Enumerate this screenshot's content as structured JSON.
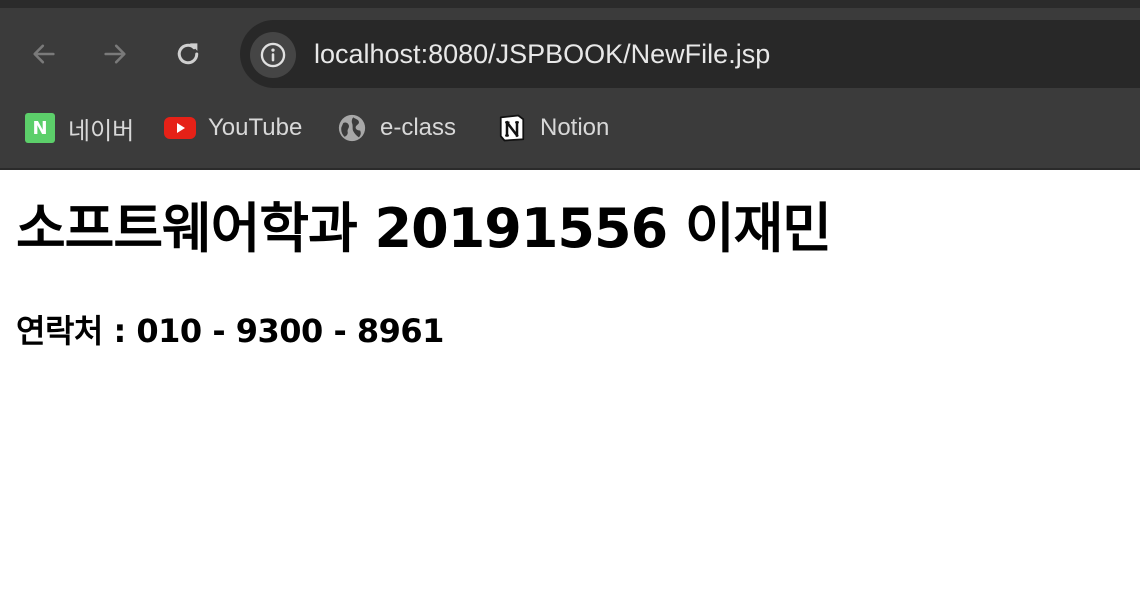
{
  "browser": {
    "url": "localhost:8080/JSPBOOK/NewFile.jsp",
    "toolbar_icons": [
      "back-arrow-icon",
      "forward-arrow-icon",
      "reload-icon",
      "info-icon"
    ],
    "bookmarks": [
      {
        "label": "네이버",
        "icon": "naver-icon",
        "icon_text": "N",
        "color": "#5ccf6a"
      },
      {
        "label": "YouTube",
        "icon": "youtube-icon",
        "color": "#e62117"
      },
      {
        "label": "e-class",
        "icon": "globe-icon"
      },
      {
        "label": "Notion",
        "icon": "notion-icon"
      }
    ]
  },
  "page": {
    "heading": "소프트웨어학과 20191556 이재민",
    "contact": "연락처 : 010 - 9300 - 8961"
  }
}
